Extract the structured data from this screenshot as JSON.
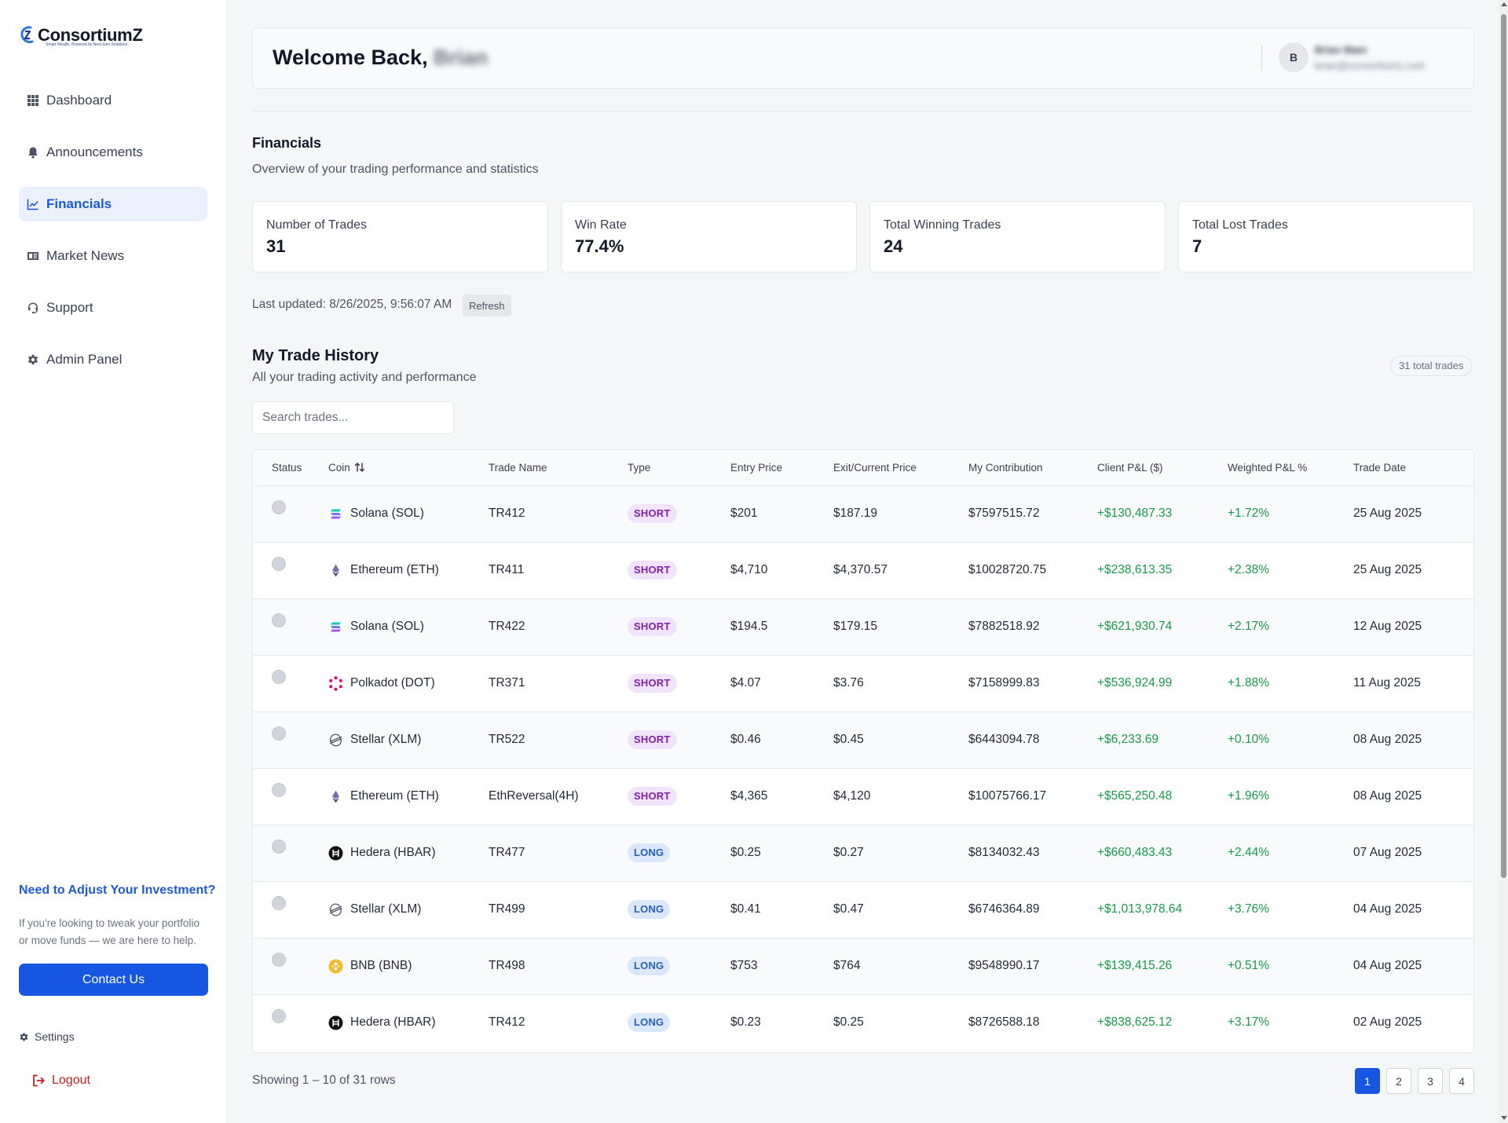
{
  "brand": {
    "name": "ConsortiumZ",
    "tagline": "Smart Wealth, Powered by Next-Gen Solutions",
    "accent": "#1656e0"
  },
  "sidebar": {
    "items": [
      {
        "label": "Dashboard",
        "icon": "grid-icon",
        "active": false
      },
      {
        "label": "Announcements",
        "icon": "bell-icon",
        "active": false
      },
      {
        "label": "Financials",
        "icon": "chart-line-icon",
        "active": true
      },
      {
        "label": "Market News",
        "icon": "newspaper-icon",
        "active": false
      },
      {
        "label": "Support",
        "icon": "headset-icon",
        "active": false
      },
      {
        "label": "Admin Panel",
        "icon": "gear-icon",
        "active": false
      }
    ],
    "promo": {
      "title": "Need to Adjust Your Investment?",
      "text": "If you're looking to tweak your portfolio or move funds — we are here to help.",
      "button": "Contact Us"
    },
    "settings_label": "Settings",
    "logout_label": "Logout"
  },
  "header": {
    "welcome": "Welcome Back,",
    "user_first_name": "Brian",
    "avatar_initial": "B",
    "user_full_name": "Brian Main",
    "user_email": "brian@consortiumz.com"
  },
  "financials": {
    "title": "Financials",
    "subtitle": "Overview of your trading performance and statistics",
    "stats": [
      {
        "label": "Number of Trades",
        "value": "31"
      },
      {
        "label": "Win Rate",
        "value": "77.4%"
      },
      {
        "label": "Total Winning Trades",
        "value": "24"
      },
      {
        "label": "Total Lost Trades",
        "value": "7"
      }
    ],
    "last_updated": "Last updated: 8/26/2025, 9:56:07 AM",
    "refresh_label": "Refresh"
  },
  "history": {
    "title": "My Trade History",
    "subtitle": "All your trading activity and performance",
    "total_badge": "31 total trades",
    "search_placeholder": "Search trades...",
    "columns": [
      "Status",
      "Coin",
      "Trade Name",
      "Type",
      "Entry Price",
      "Exit/Current Price",
      "My Contribution",
      "Client P&L ($)",
      "Weighted P&L %",
      "Trade Date"
    ],
    "rows": [
      {
        "coin": "Solana (SOL)",
        "icon": "solana",
        "trade": "TR412",
        "type": "SHORT",
        "entry": "$201",
        "exit": "$187.19",
        "contribution": "$7597515.72",
        "pnl": "+$130,487.33",
        "wpnl": "+1.72%",
        "date": "25 Aug 2025"
      },
      {
        "coin": "Ethereum (ETH)",
        "icon": "ethereum",
        "trade": "TR411",
        "type": "SHORT",
        "entry": "$4,710",
        "exit": "$4,370.57",
        "contribution": "$10028720.75",
        "pnl": "+$238,613.35",
        "wpnl": "+2.38%",
        "date": "25 Aug 2025"
      },
      {
        "coin": "Solana (SOL)",
        "icon": "solana",
        "trade": "TR422",
        "type": "SHORT",
        "entry": "$194.5",
        "exit": "$179.15",
        "contribution": "$7882518.92",
        "pnl": "+$621,930.74",
        "wpnl": "+2.17%",
        "date": "12 Aug 2025"
      },
      {
        "coin": "Polkadot (DOT)",
        "icon": "polkadot",
        "trade": "TR371",
        "type": "SHORT",
        "entry": "$4.07",
        "exit": "$3.76",
        "contribution": "$7158999.83",
        "pnl": "+$536,924.99",
        "wpnl": "+1.88%",
        "date": "11 Aug 2025"
      },
      {
        "coin": "Stellar (XLM)",
        "icon": "stellar",
        "trade": "TR522",
        "type": "SHORT",
        "entry": "$0.46",
        "exit": "$0.45",
        "contribution": "$6443094.78",
        "pnl": "+$6,233.69",
        "wpnl": "+0.10%",
        "date": "08 Aug 2025"
      },
      {
        "coin": "Ethereum (ETH)",
        "icon": "ethereum",
        "trade": "EthReversal(4H)",
        "type": "SHORT",
        "entry": "$4,365",
        "exit": "$4,120",
        "contribution": "$10075766.17",
        "pnl": "+$565,250.48",
        "wpnl": "+1.96%",
        "date": "08 Aug 2025"
      },
      {
        "coin": "Hedera (HBAR)",
        "icon": "hedera",
        "trade": "TR477",
        "type": "LONG",
        "entry": "$0.25",
        "exit": "$0.27",
        "contribution": "$8134032.43",
        "pnl": "+$660,483.43",
        "wpnl": "+2.44%",
        "date": "07 Aug 2025"
      },
      {
        "coin": "Stellar (XLM)",
        "icon": "stellar",
        "trade": "TR499",
        "type": "LONG",
        "entry": "$0.41",
        "exit": "$0.47",
        "contribution": "$6746364.89",
        "pnl": "+$1,013,978.64",
        "wpnl": "+3.76%",
        "date": "04 Aug 2025"
      },
      {
        "coin": "BNB (BNB)",
        "icon": "bnb",
        "trade": "TR498",
        "type": "LONG",
        "entry": "$753",
        "exit": "$764",
        "contribution": "$9548990.17",
        "pnl": "+$139,415.26",
        "wpnl": "+0.51%",
        "date": "04 Aug 2025"
      },
      {
        "coin": "Hedera (HBAR)",
        "icon": "hedera",
        "trade": "TR412",
        "type": "LONG",
        "entry": "$0.23",
        "exit": "$0.25",
        "contribution": "$8726588.18",
        "pnl": "+$838,625.12",
        "wpnl": "+3.17%",
        "date": "02 Aug 2025"
      }
    ],
    "showing": "Showing 1 – 10 of 31 rows",
    "pages": [
      "1",
      "2",
      "3",
      "4"
    ],
    "current_page": "1"
  },
  "colors": {
    "gain": "#179a48",
    "short_bg": "#f1e3fb",
    "short_fg": "#7e22a9",
    "long_bg": "#dbe8fc",
    "long_fg": "#2a5fb8"
  }
}
